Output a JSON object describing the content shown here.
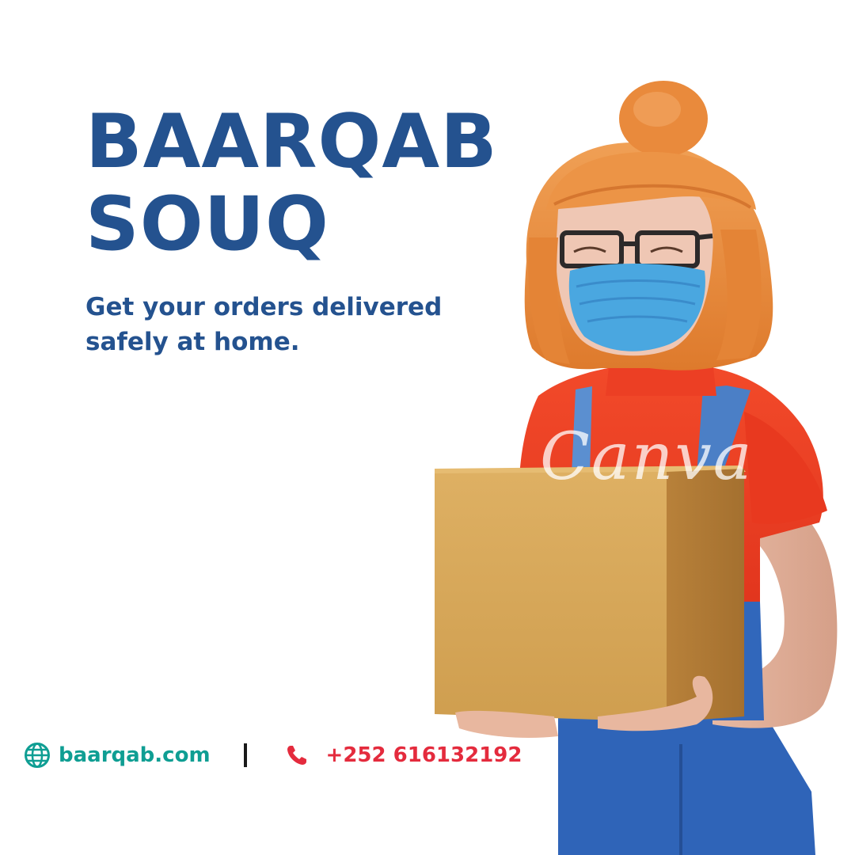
{
  "brand": {
    "title_line1": "BAARQAB",
    "title_line2": "SOUQ",
    "tagline_line1": "Get your orders delivered",
    "tagline_line2": "safely at home."
  },
  "footer": {
    "website": "baarqab.com",
    "phone": "+252 616132192",
    "website_icon": "globe-icon",
    "phone_icon": "phone-icon"
  },
  "watermark": "Canva",
  "colors": {
    "heading": "#24528f",
    "website": "#0f9e93",
    "phone": "#e42b3d",
    "hair": "#e9893b",
    "shirt": "#ee3d22",
    "overalls": "#2f64b8",
    "box": "#d8a756",
    "mask": "#4aa7e0"
  }
}
